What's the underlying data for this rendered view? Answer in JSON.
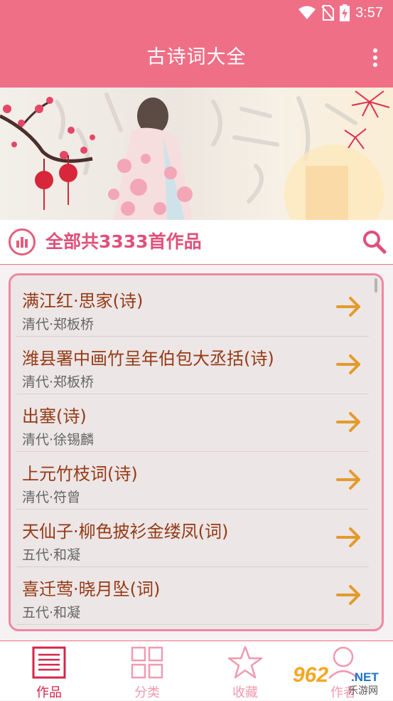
{
  "status_bar": {
    "time": "3:57",
    "icons": [
      "wifi-icon",
      "no-sim-icon",
      "battery-charging-icon"
    ]
  },
  "app_bar": {
    "title": "古诗词大全",
    "menu_icon": "more-vertical-icon"
  },
  "banner": {
    "description_icon": "plum-blossom-illustration"
  },
  "count_bar": {
    "text": "全部共3333首作品",
    "icon": "chart-icon",
    "search_icon": "search-icon"
  },
  "poems": [
    {
      "title": "满江红·思家(诗)",
      "author": "清代·郑板桥"
    },
    {
      "title": "潍县署中画竹呈年伯包大丞括(诗)",
      "author": "清代·郑板桥"
    },
    {
      "title": "出塞(诗)",
      "author": "清代·徐锡麟"
    },
    {
      "title": "上元竹枝词(诗)",
      "author": "清代·符曾"
    },
    {
      "title": "天仙子·柳色披衫金缕凤(词)",
      "author": "五代·和凝"
    },
    {
      "title": "喜迁莺·晓月坠(词)",
      "author": "五代·和凝"
    }
  ],
  "bottom_nav": [
    {
      "label": "作品",
      "icon": "list-icon",
      "active": true
    },
    {
      "label": "分类",
      "icon": "grid-icon",
      "active": false
    },
    {
      "label": "收藏",
      "icon": "star-icon",
      "active": false
    },
    {
      "label": "作者",
      "icon": "person-icon",
      "active": false
    }
  ],
  "watermark": {
    "number": "962",
    "net": ".NET",
    "site": "乐游网"
  },
  "colors": {
    "primary": "#ef6f87",
    "title_text": "#963a14",
    "arrow": "#e49a2a",
    "accent_text": "#e0507a"
  }
}
